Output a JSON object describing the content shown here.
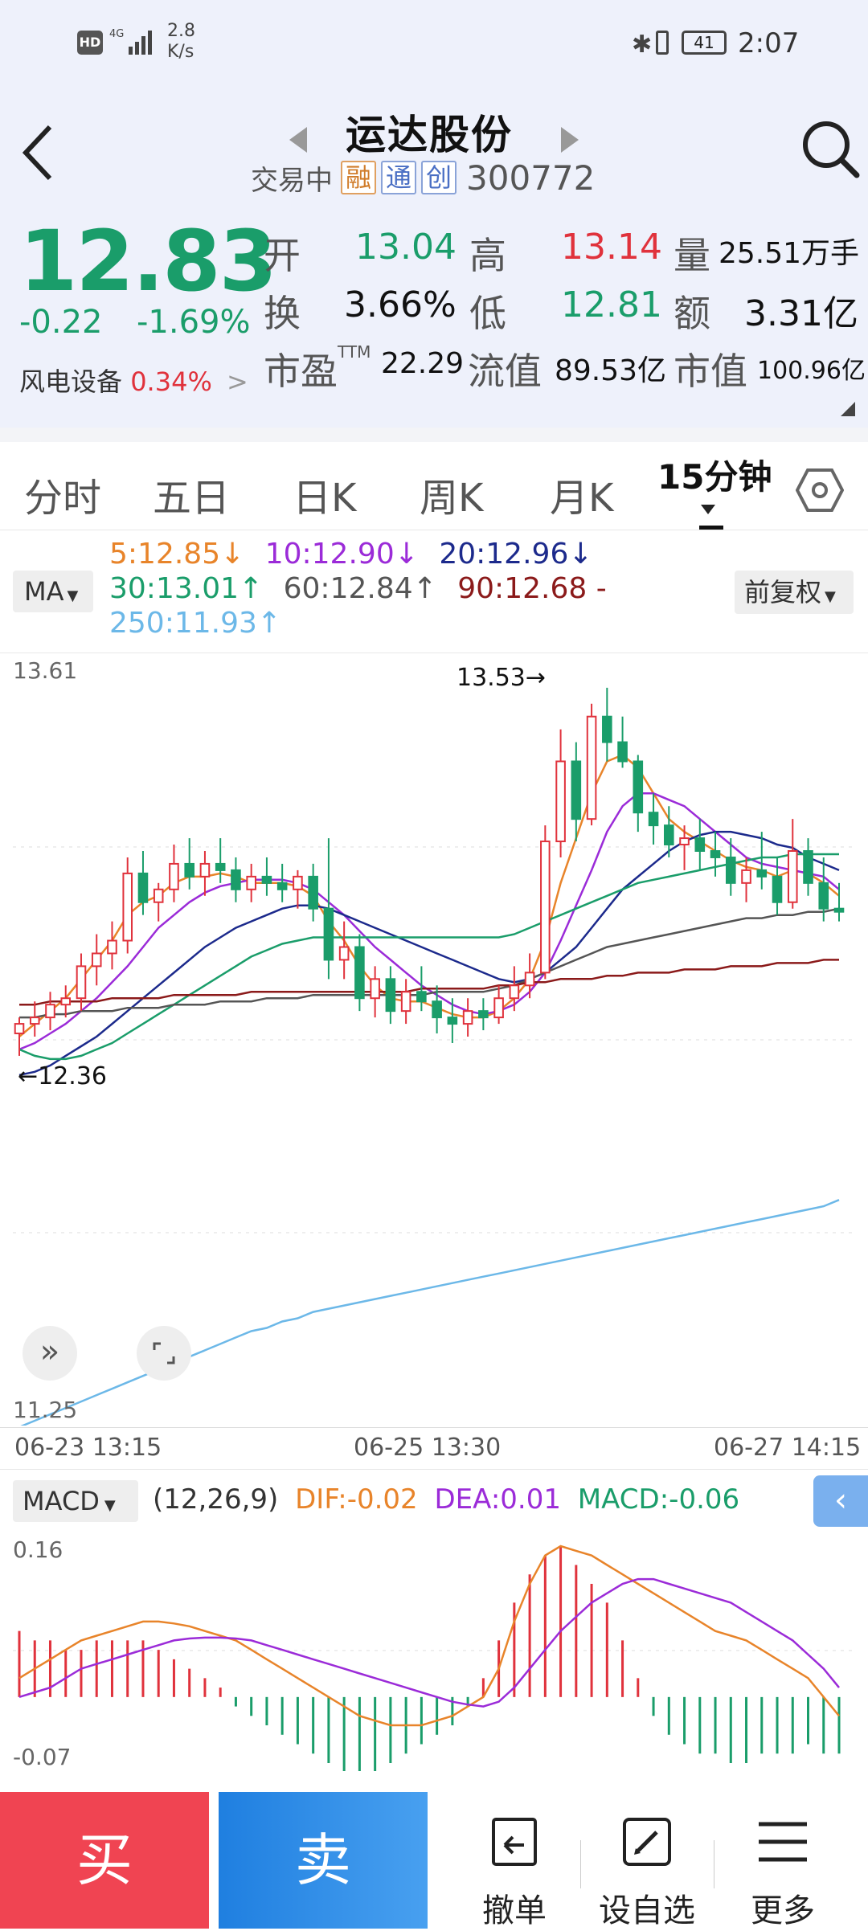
{
  "status": {
    "net_speed_top": "2.8",
    "net_speed_unit": "K/s",
    "battery": "41",
    "time": "2:07"
  },
  "header": {
    "title": "运达股份",
    "trading_state": "交易中",
    "chips": [
      "融",
      "通",
      "创"
    ],
    "code": "300772"
  },
  "quote": {
    "price": "12.83",
    "change": "-0.22",
    "change_pct": "-1.69%",
    "sector_name": "风电设备",
    "sector_pct": "0.34%",
    "labels": {
      "open": "开",
      "high": "高",
      "volume": "量",
      "turnover": "换",
      "low": "低",
      "amount": "额",
      "pe": "市盈",
      "pe_sup": "TTM",
      "float_cap": "流值",
      "mkt_cap": "市值"
    },
    "open": "13.04",
    "high": "13.14",
    "volume": "25.51万手",
    "turnover": "3.66%",
    "low": "12.81",
    "amount": "3.31亿",
    "pe": "22.29",
    "float_cap": "89.53亿",
    "mkt_cap": "100.96亿"
  },
  "tabs": [
    "分时",
    "五日",
    "日K",
    "周K",
    "月K",
    "15分钟"
  ],
  "ma": {
    "button": "MA",
    "adjust": "前复权",
    "items": [
      {
        "text": "5:12.85↓",
        "color": "#e8842a"
      },
      {
        "text": "10:12.90↓",
        "color": "#9b2bd8"
      },
      {
        "text": "20:12.96↓",
        "color": "#1c2a8c"
      },
      {
        "text": "30:13.01↑",
        "color": "#1a9d6a"
      },
      {
        "text": "60:12.84↑",
        "color": "#555555"
      },
      {
        "text": "90:12.68 -",
        "color": "#8b1a1a"
      },
      {
        "text": "250:11.93↑",
        "color": "#6cb8e8"
      }
    ]
  },
  "chart": {
    "y_top": "13.61",
    "y_bottom": "11.25",
    "high_mark": "13.53→",
    "low_mark": "←12.36",
    "x_labels": [
      "06-23 13:15",
      "06-25 13:30",
      "06-27 14:15"
    ]
  },
  "macd": {
    "button": "MACD",
    "params": "(12,26,9)",
    "dif": "DIF:-0.02",
    "dea": "DEA:0.01",
    "macd_val": "MACD:-0.06",
    "y_top": "0.16",
    "y_bottom": "-0.07"
  },
  "chart_data": {
    "type": "candlestick",
    "interval": "15分钟",
    "ylim": [
      11.25,
      13.61
    ],
    "x_ticks": [
      "06-23 13:15",
      "06-25 13:30",
      "06-27 14:15"
    ],
    "candles": [
      [
        12.45,
        12.5,
        12.38,
        12.48
      ],
      [
        12.48,
        12.55,
        12.44,
        12.5
      ],
      [
        12.5,
        12.58,
        12.46,
        12.54
      ],
      [
        12.54,
        12.6,
        12.5,
        12.56
      ],
      [
        12.56,
        12.7,
        12.52,
        12.66
      ],
      [
        12.66,
        12.76,
        12.6,
        12.7
      ],
      [
        12.7,
        12.8,
        12.65,
        12.74
      ],
      [
        12.74,
        13.0,
        12.7,
        12.95
      ],
      [
        12.95,
        13.02,
        12.82,
        12.86
      ],
      [
        12.86,
        12.92,
        12.8,
        12.9
      ],
      [
        12.9,
        13.04,
        12.86,
        12.98
      ],
      [
        12.98,
        13.06,
        12.9,
        12.94
      ],
      [
        12.94,
        13.02,
        12.88,
        12.98
      ],
      [
        12.98,
        13.06,
        12.92,
        12.96
      ],
      [
        12.96,
        13.0,
        12.86,
        12.9
      ],
      [
        12.9,
        12.98,
        12.86,
        12.94
      ],
      [
        12.94,
        13.0,
        12.88,
        12.92
      ],
      [
        12.92,
        12.98,
        12.86,
        12.9
      ],
      [
        12.9,
        12.96,
        12.84,
        12.94
      ],
      [
        12.94,
        12.98,
        12.8,
        12.84
      ],
      [
        12.84,
        13.06,
        12.62,
        12.68
      ],
      [
        12.68,
        12.8,
        12.62,
        12.72
      ],
      [
        12.72,
        12.76,
        12.52,
        12.56
      ],
      [
        12.56,
        12.66,
        12.5,
        12.62
      ],
      [
        12.62,
        12.66,
        12.48,
        12.52
      ],
      [
        12.52,
        12.62,
        12.48,
        12.58
      ],
      [
        12.58,
        12.66,
        12.52,
        12.55
      ],
      [
        12.55,
        12.6,
        12.45,
        12.5
      ],
      [
        12.5,
        12.56,
        12.42,
        12.48
      ],
      [
        12.48,
        12.56,
        12.44,
        12.52
      ],
      [
        12.52,
        12.56,
        12.46,
        12.5
      ],
      [
        12.5,
        12.6,
        12.48,
        12.56
      ],
      [
        12.56,
        12.66,
        12.52,
        12.6
      ],
      [
        12.6,
        12.7,
        12.56,
        12.64
      ],
      [
        12.64,
        13.1,
        12.62,
        13.05
      ],
      [
        13.05,
        13.4,
        13.0,
        13.3
      ],
      [
        13.3,
        13.36,
        13.05,
        13.12
      ],
      [
        13.12,
        13.48,
        13.1,
        13.44
      ],
      [
        13.44,
        13.53,
        13.3,
        13.36
      ],
      [
        13.36,
        13.44,
        13.28,
        13.3
      ],
      [
        13.3,
        13.32,
        13.08,
        13.14
      ],
      [
        13.14,
        13.2,
        13.04,
        13.1
      ],
      [
        13.1,
        13.16,
        13.0,
        13.04
      ],
      [
        13.04,
        13.1,
        12.96,
        13.06
      ],
      [
        13.06,
        13.12,
        12.96,
        13.02
      ],
      [
        13.02,
        13.08,
        12.94,
        13.0
      ],
      [
        13.0,
        13.06,
        12.88,
        12.92
      ],
      [
        12.92,
        13.0,
        12.86,
        12.96
      ],
      [
        12.96,
        13.08,
        12.9,
        12.94
      ],
      [
        12.94,
        13.0,
        12.82,
        12.86
      ],
      [
        12.86,
        13.12,
        12.84,
        13.02
      ],
      [
        13.02,
        13.06,
        12.88,
        12.92
      ],
      [
        12.92,
        13.0,
        12.8,
        12.84
      ],
      [
        12.84,
        12.92,
        12.8,
        12.83
      ]
    ],
    "ma_lines": {
      "MA5": [
        12.44,
        12.48,
        12.52,
        12.56,
        12.62,
        12.68,
        12.74,
        12.82,
        12.86,
        12.88,
        12.92,
        12.94,
        12.94,
        12.95,
        12.94,
        12.92,
        12.92,
        12.92,
        12.91,
        12.88,
        12.8,
        12.74,
        12.66,
        12.6,
        12.56,
        12.55,
        12.55,
        12.53,
        12.51,
        12.5,
        12.5,
        12.52,
        12.56,
        12.62,
        12.74,
        12.92,
        13.06,
        13.2,
        13.3,
        13.32,
        13.28,
        13.2,
        13.12,
        13.08,
        13.05,
        13.02,
        12.99,
        12.97,
        12.96,
        12.94,
        12.96,
        12.95,
        12.92,
        12.88
      ],
      "MA10": [
        12.4,
        12.42,
        12.45,
        12.48,
        12.52,
        12.56,
        12.61,
        12.66,
        12.72,
        12.78,
        12.82,
        12.86,
        12.89,
        12.91,
        12.92,
        12.93,
        12.93,
        12.93,
        12.92,
        12.9,
        12.86,
        12.82,
        12.77,
        12.72,
        12.68,
        12.64,
        12.6,
        12.57,
        12.54,
        12.52,
        12.51,
        12.52,
        12.54,
        12.58,
        12.64,
        12.74,
        12.85,
        12.96,
        13.08,
        13.16,
        13.2,
        13.2,
        13.18,
        13.16,
        13.12,
        13.08,
        13.04,
        13.0,
        12.98,
        12.97,
        12.96,
        12.95,
        12.94,
        12.9
      ],
      "MA20": [
        12.32,
        12.33,
        12.35,
        12.38,
        12.41,
        12.44,
        12.48,
        12.52,
        12.56,
        12.6,
        12.64,
        12.68,
        12.72,
        12.75,
        12.78,
        12.8,
        12.82,
        12.84,
        12.85,
        12.85,
        12.84,
        12.82,
        12.8,
        12.78,
        12.76,
        12.74,
        12.72,
        12.7,
        12.68,
        12.66,
        12.64,
        12.62,
        12.61,
        12.62,
        12.64,
        12.68,
        12.72,
        12.78,
        12.84,
        12.9,
        12.94,
        12.98,
        13.02,
        13.05,
        13.07,
        13.08,
        13.08,
        13.07,
        13.06,
        13.04,
        13.03,
        13.0,
        12.98,
        12.96
      ],
      "MA30": [
        12.4,
        12.38,
        12.37,
        12.37,
        12.38,
        12.4,
        12.42,
        12.45,
        12.48,
        12.51,
        12.54,
        12.57,
        12.6,
        12.63,
        12.66,
        12.69,
        12.71,
        12.73,
        12.74,
        12.75,
        12.75,
        12.75,
        12.75,
        12.75,
        12.75,
        12.75,
        12.75,
        12.75,
        12.75,
        12.75,
        12.75,
        12.75,
        12.76,
        12.78,
        12.8,
        12.82,
        12.84,
        12.86,
        12.88,
        12.9,
        12.92,
        12.93,
        12.94,
        12.95,
        12.96,
        12.97,
        12.98,
        12.99,
        13.0,
        13.0,
        13.01,
        13.01,
        13.01,
        13.01
      ],
      "MA60": [
        12.5,
        12.5,
        12.51,
        12.51,
        12.52,
        12.52,
        12.52,
        12.53,
        12.53,
        12.53,
        12.54,
        12.54,
        12.54,
        12.55,
        12.55,
        12.55,
        12.56,
        12.56,
        12.56,
        12.57,
        12.57,
        12.57,
        12.57,
        12.57,
        12.57,
        12.57,
        12.57,
        12.58,
        12.58,
        12.58,
        12.58,
        12.59,
        12.6,
        12.62,
        12.64,
        12.66,
        12.68,
        12.7,
        12.72,
        12.73,
        12.74,
        12.75,
        12.76,
        12.77,
        12.78,
        12.79,
        12.8,
        12.81,
        12.81,
        12.82,
        12.82,
        12.83,
        12.83,
        12.84
      ],
      "MA90": [
        12.54,
        12.54,
        12.55,
        12.55,
        12.55,
        12.55,
        12.56,
        12.56,
        12.56,
        12.56,
        12.57,
        12.57,
        12.57,
        12.57,
        12.57,
        12.58,
        12.58,
        12.58,
        12.58,
        12.58,
        12.58,
        12.58,
        12.58,
        12.58,
        12.58,
        12.58,
        12.59,
        12.59,
        12.59,
        12.59,
        12.59,
        12.6,
        12.6,
        12.61,
        12.61,
        12.62,
        12.62,
        12.62,
        12.63,
        12.63,
        12.64,
        12.64,
        12.64,
        12.65,
        12.65,
        12.65,
        12.66,
        12.66,
        12.66,
        12.67,
        12.67,
        12.67,
        12.68,
        12.68
      ],
      "MA250": [
        11.22,
        11.24,
        11.26,
        11.28,
        11.3,
        11.32,
        11.34,
        11.36,
        11.38,
        11.4,
        11.42,
        11.44,
        11.46,
        11.48,
        11.5,
        11.52,
        11.53,
        11.55,
        11.56,
        11.58,
        11.59,
        11.6,
        11.61,
        11.62,
        11.63,
        11.64,
        11.65,
        11.66,
        11.67,
        11.68,
        11.69,
        11.7,
        11.71,
        11.72,
        11.73,
        11.74,
        11.75,
        11.76,
        11.77,
        11.78,
        11.79,
        11.8,
        11.81,
        11.82,
        11.83,
        11.84,
        11.85,
        11.86,
        11.87,
        11.88,
        11.89,
        11.9,
        11.91,
        11.93
      ]
    },
    "macd_ylim": [
      -0.07,
      0.16
    ],
    "dif": [
      0.02,
      0.03,
      0.04,
      0.05,
      0.06,
      0.065,
      0.07,
      0.075,
      0.08,
      0.08,
      0.078,
      0.075,
      0.07,
      0.065,
      0.06,
      0.05,
      0.04,
      0.03,
      0.02,
      0.01,
      0.0,
      -0.01,
      -0.02,
      -0.025,
      -0.03,
      -0.03,
      -0.03,
      -0.025,
      -0.02,
      -0.01,
      0.0,
      0.03,
      0.08,
      0.12,
      0.15,
      0.16,
      0.155,
      0.15,
      0.14,
      0.13,
      0.12,
      0.11,
      0.1,
      0.09,
      0.08,
      0.07,
      0.065,
      0.06,
      0.05,
      0.04,
      0.03,
      0.02,
      0.0,
      -0.02
    ],
    "dea": [
      0.0,
      0.005,
      0.01,
      0.02,
      0.03,
      0.035,
      0.04,
      0.045,
      0.05,
      0.055,
      0.06,
      0.062,
      0.063,
      0.063,
      0.062,
      0.06,
      0.055,
      0.05,
      0.045,
      0.04,
      0.035,
      0.03,
      0.025,
      0.02,
      0.015,
      0.01,
      0.005,
      0.0,
      -0.005,
      -0.008,
      -0.01,
      -0.005,
      0.01,
      0.03,
      0.05,
      0.07,
      0.085,
      0.1,
      0.11,
      0.12,
      0.125,
      0.125,
      0.12,
      0.115,
      0.11,
      0.105,
      0.1,
      0.09,
      0.08,
      0.07,
      0.06,
      0.045,
      0.03,
      0.01
    ],
    "hist": [
      0.07,
      0.06,
      0.06,
      0.05,
      0.05,
      0.06,
      0.06,
      0.06,
      0.06,
      0.05,
      0.04,
      0.03,
      0.02,
      0.01,
      -0.01,
      -0.02,
      -0.03,
      -0.04,
      -0.05,
      -0.06,
      -0.07,
      -0.08,
      -0.09,
      -0.08,
      -0.07,
      -0.06,
      -0.05,
      -0.04,
      -0.03,
      -0.01,
      0.02,
      0.06,
      0.1,
      0.13,
      0.15,
      0.16,
      0.14,
      0.12,
      0.1,
      0.06,
      0.02,
      -0.02,
      -0.04,
      -0.05,
      -0.06,
      -0.06,
      -0.07,
      -0.07,
      -0.06,
      -0.06,
      -0.06,
      -0.05,
      -0.06,
      -0.06
    ]
  },
  "bottom": {
    "buy": "买",
    "sell": "卖",
    "cancel": "撤单",
    "watch": "设自选",
    "more": "更多"
  }
}
